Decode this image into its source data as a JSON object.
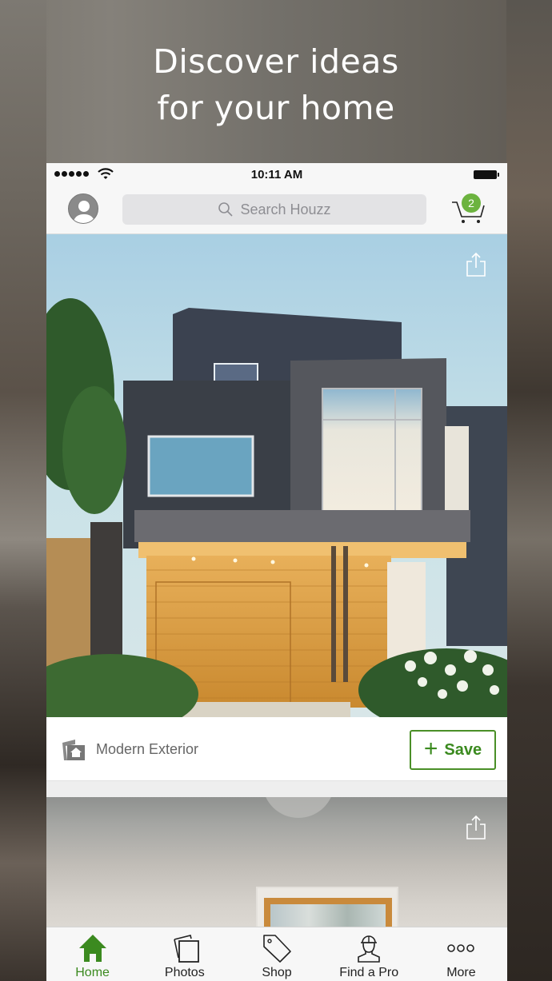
{
  "promo": {
    "headline_line1": "Discover ideas",
    "headline_line2": "for your home"
  },
  "status_bar": {
    "time": "10:11 AM",
    "signal_bars": 5,
    "wifi": "wifi-icon",
    "battery": "full"
  },
  "nav_bar": {
    "profile_icon": "user-avatar-icon",
    "search_placeholder": "Search Houzz",
    "cart_icon": "shopping-cart-icon",
    "cart_count": "2"
  },
  "feed": {
    "cards": [
      {
        "image_description": "Modern house exterior at dusk",
        "share_icon": "share-icon",
        "category_icon": "ideabook-home-icon",
        "caption": "Modern Exterior",
        "save_label": "Save",
        "save_icon": "plus-icon"
      },
      {
        "image_description": "Interior room with wooden window frame",
        "share_icon": "share-icon"
      }
    ]
  },
  "tab_bar": {
    "items": [
      {
        "label": "Home",
        "icon": "home-icon",
        "active": true
      },
      {
        "label": "Photos",
        "icon": "photos-icon",
        "active": false
      },
      {
        "label": "Shop",
        "icon": "tag-icon",
        "active": false
      },
      {
        "label": "Find a Pro",
        "icon": "pro-worker-icon",
        "active": false
      },
      {
        "label": "More",
        "icon": "more-dots-icon",
        "active": false
      }
    ]
  },
  "colors": {
    "accent_green": "#3b8a1f",
    "badge_green": "#6cb33f",
    "text_gray": "#666666"
  }
}
